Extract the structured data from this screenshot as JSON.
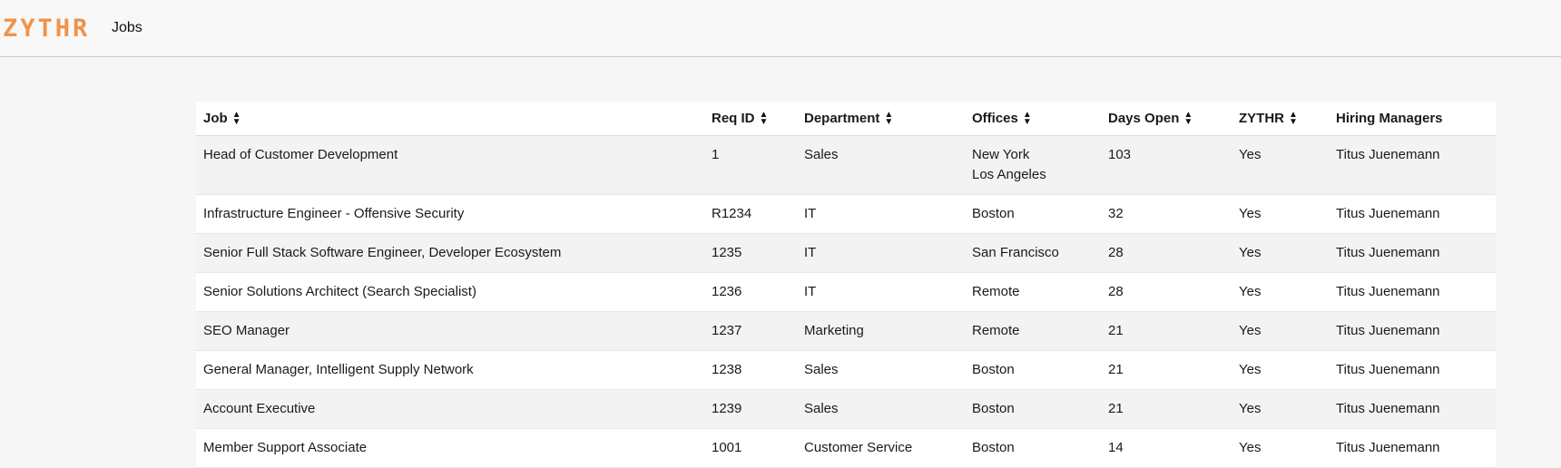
{
  "brand": {
    "logo": "ZYTHR",
    "logo_color": "#f0934a"
  },
  "nav": {
    "jobs_label": "Jobs"
  },
  "table": {
    "columns": [
      {
        "label": "Job",
        "sortable": true
      },
      {
        "label": "Req ID",
        "sortable": true
      },
      {
        "label": "Department",
        "sortable": true
      },
      {
        "label": "Offices",
        "sortable": true
      },
      {
        "label": "Days Open",
        "sortable": true
      },
      {
        "label": "ZYTHR",
        "sortable": true
      },
      {
        "label": "Hiring Managers",
        "sortable": false
      }
    ],
    "rows": [
      {
        "job": "Head of Customer Development",
        "req_id": "1",
        "department": "Sales",
        "offices": [
          "New York",
          "Los Angeles"
        ],
        "days_open": "103",
        "zythr": "Yes",
        "hiring_managers": "Titus Juenemann"
      },
      {
        "job": "Infrastructure Engineer - Offensive Security",
        "req_id": "R1234",
        "department": "IT",
        "offices": [
          "Boston"
        ],
        "days_open": "32",
        "zythr": "Yes",
        "hiring_managers": "Titus Juenemann"
      },
      {
        "job": "Senior Full Stack Software Engineer, Developer Ecosystem",
        "req_id": "1235",
        "department": "IT",
        "offices": [
          "San Francisco"
        ],
        "days_open": "28",
        "zythr": "Yes",
        "hiring_managers": "Titus Juenemann"
      },
      {
        "job": "Senior Solutions Architect (Search Specialist)",
        "req_id": "1236",
        "department": "IT",
        "offices": [
          "Remote"
        ],
        "days_open": "28",
        "zythr": "Yes",
        "hiring_managers": "Titus Juenemann"
      },
      {
        "job": "SEO Manager",
        "req_id": "1237",
        "department": "Marketing",
        "offices": [
          "Remote"
        ],
        "days_open": "21",
        "zythr": "Yes",
        "hiring_managers": "Titus Juenemann"
      },
      {
        "job": "General Manager, Intelligent Supply Network",
        "req_id": "1238",
        "department": "Sales",
        "offices": [
          "Boston"
        ],
        "days_open": "21",
        "zythr": "Yes",
        "hiring_managers": "Titus Juenemann"
      },
      {
        "job": "Account Executive",
        "req_id": "1239",
        "department": "Sales",
        "offices": [
          "Boston"
        ],
        "days_open": "21",
        "zythr": "Yes",
        "hiring_managers": "Titus Juenemann"
      },
      {
        "job": "Member Support Associate",
        "req_id": "1001",
        "department": "Customer Service",
        "offices": [
          "Boston"
        ],
        "days_open": "14",
        "zythr": "Yes",
        "hiring_managers": "Titus Juenemann"
      }
    ]
  }
}
